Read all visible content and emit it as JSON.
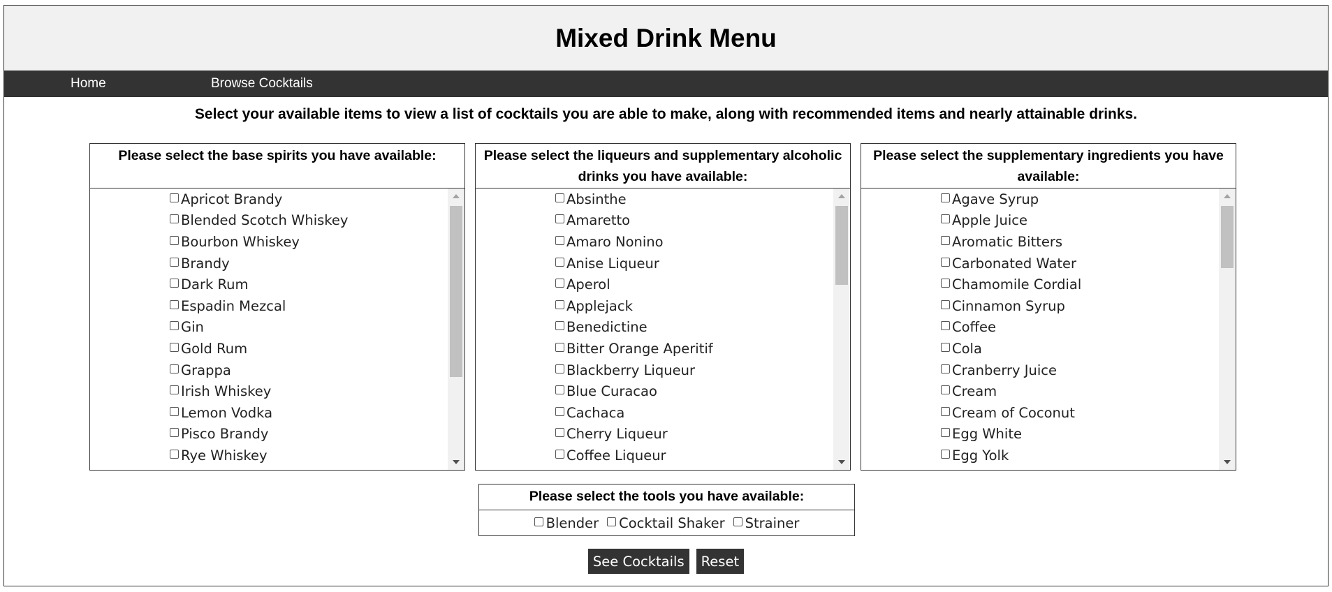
{
  "header": {
    "title": "Mixed Drink Menu"
  },
  "nav": {
    "home": "Home",
    "browse": "Browse Cocktails"
  },
  "intro": "Select your available items to view a list of cocktails you are able to make, along with recommended items and nearly attainable drinks.",
  "spirits": {
    "heading": "Please select the base spirits you have available:",
    "items": [
      "Apricot Brandy",
      "Blended Scotch Whiskey",
      "Bourbon Whiskey",
      "Brandy",
      "Dark Rum",
      "Espadin Mezcal",
      "Gin",
      "Gold Rum",
      "Grappa",
      "Irish Whiskey",
      "Lemon Vodka",
      "Pisco Brandy",
      "Rye Whiskey"
    ]
  },
  "liqueurs": {
    "heading": "Please select the liqueurs and supplementary alcoholic drinks you have available:",
    "items": [
      "Absinthe",
      "Amaretto",
      "Amaro Nonino",
      "Anise Liqueur",
      "Aperol",
      "Applejack",
      "Benedictine",
      "Bitter Orange Aperitif",
      "Blackberry Liqueur",
      "Blue Curacao",
      "Cachaca",
      "Cherry Liqueur",
      "Coffee Liqueur"
    ]
  },
  "ingredients": {
    "heading": "Please select the supplementary ingredients you have available:",
    "items": [
      "Agave Syrup",
      "Apple Juice",
      "Aromatic Bitters",
      "Carbonated Water",
      "Chamomile Cordial",
      "Cinnamon Syrup",
      "Coffee",
      "Cola",
      "Cranberry Juice",
      "Cream",
      "Cream of Coconut",
      "Egg White",
      "Egg Yolk"
    ]
  },
  "tools": {
    "heading": "Please select the tools you have available:",
    "items": [
      "Blender",
      "Cocktail Shaker",
      "Strainer"
    ]
  },
  "buttons": {
    "see": "See Cocktails",
    "reset": "Reset"
  }
}
